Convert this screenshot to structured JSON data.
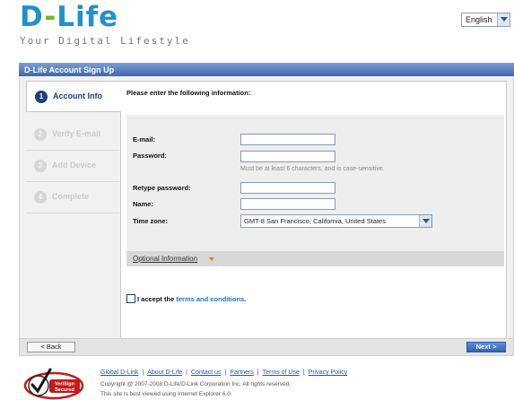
{
  "logo": {
    "text_main": "D",
    "text_dash": "-",
    "text_rest": "Life",
    "tagline": "Your Digital Lifestyle"
  },
  "language": {
    "selected": "English"
  },
  "header": {
    "title": "D-Life Account Sign Up"
  },
  "steps": [
    {
      "num": "1",
      "label": "Account Info",
      "active": true
    },
    {
      "num": "2",
      "label": "Verify E-mail",
      "active": false
    },
    {
      "num": "3",
      "label": "Add Device",
      "active": false
    },
    {
      "num": "4",
      "label": "Complete",
      "active": false
    }
  ],
  "form": {
    "prompt": "Please enter the following information:",
    "email_label": "E-mail:",
    "password_label": "Password:",
    "password_hint": "Must be at least 6 characters, and is case-sensitive.",
    "retype_label": "Retype password:",
    "name_label": "Name:",
    "timezone_label": "Time zone:",
    "timezone_value": "GMT-8 San Francisco, California, United States"
  },
  "optional": {
    "label": "Optional Information"
  },
  "accept": {
    "prefix": "I accept the ",
    "link": "terms and conditions",
    "suffix": "."
  },
  "buttons": {
    "back": "< Back",
    "next": "Next >"
  },
  "footer": {
    "links": [
      "Global D-Link",
      "About D-Life",
      "Contact us",
      "Partners",
      "Terms of Use",
      "Privacy Policy"
    ],
    "copyright": "Copyright @ 2007-2008 D-Life/D-Link Corporation Inc. All rights reserved.",
    "browser_note": "This site is best viewed using Internet Explorer 6.0.",
    "verisign_line1": "VeriSign",
    "verisign_line2": "Secured"
  },
  "colors": {
    "brand_blue": "#1f92cc",
    "brand_green": "#76b52d",
    "header_blue": "#3e67ad",
    "step_active": "#1c3e7a"
  }
}
